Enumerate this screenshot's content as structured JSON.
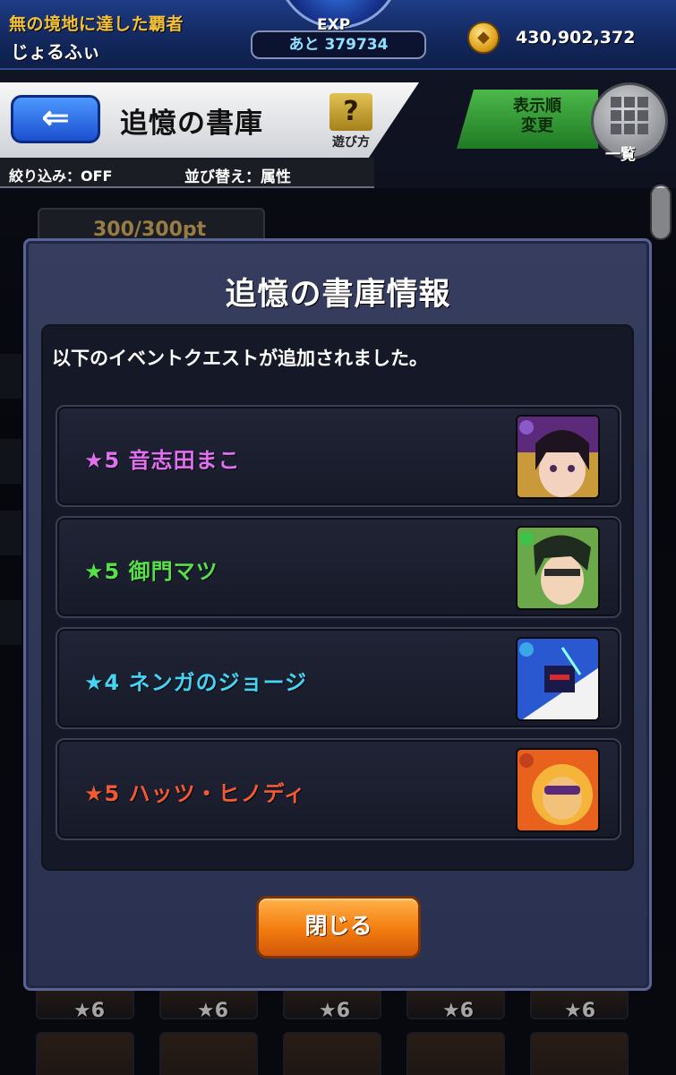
{
  "status": {
    "rank_title": "無の境地に達した覇者",
    "player_name": "じょるふぃ",
    "exp_label": "EXP",
    "exp_remaining": "あと 379734",
    "coins": "430,902,372"
  },
  "header": {
    "back_arrow": "⇐",
    "title": "追憶の書庫",
    "howto_icon": "?",
    "howto_label": "遊び方",
    "filter": "絞り込み：OFF",
    "sort": "並び替え：属性",
    "order_button": "表示順\n変更",
    "list_button": "一覧"
  },
  "background": {
    "points": "300/300pt",
    "star_labels": [
      "★6",
      "★6",
      "★6",
      "★6",
      "★6"
    ]
  },
  "modal": {
    "title": "追憶の書庫情報",
    "message": "以下のイベントクエストが追加されました。",
    "quests": [
      {
        "label": "★5 音志田まこ",
        "color": "#e070f0"
      },
      {
        "label": "★5 御門マツ",
        "color": "#58e04a"
      },
      {
        "label": "★4 ネンガのジョージ",
        "color": "#46d4f4"
      },
      {
        "label": "★5 ハッツ・ヒノディ",
        "color": "#f25a34"
      }
    ],
    "close_label": "閉じる"
  },
  "colors": {
    "accent_orange": "#f27b0e",
    "modal_bg": "#2f3656",
    "gold": "#f4c23a"
  }
}
